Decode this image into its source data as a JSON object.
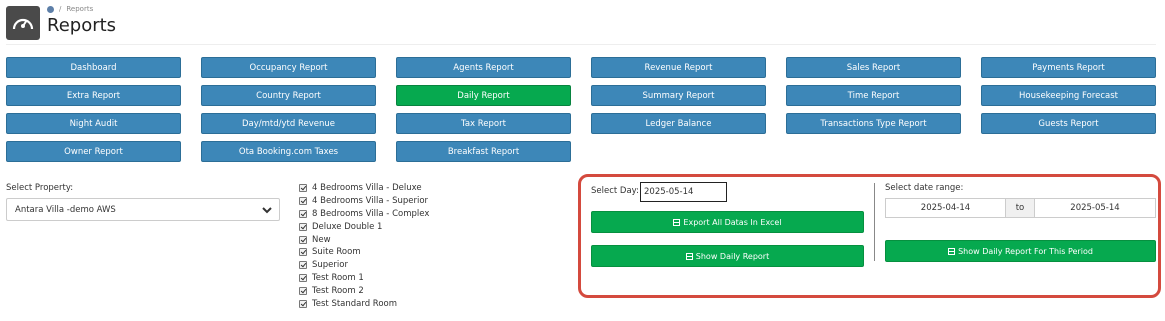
{
  "header": {
    "breadcrumb": "Reports",
    "title": "Reports"
  },
  "nav": [
    {
      "label": "Dashboard",
      "active": false
    },
    {
      "label": "Occupancy Report",
      "active": false
    },
    {
      "label": "Agents Report",
      "active": false
    },
    {
      "label": "Revenue Report",
      "active": false
    },
    {
      "label": "Sales Report",
      "active": false
    },
    {
      "label": "Payments Report",
      "active": false
    },
    {
      "label": "Extra Report",
      "active": false
    },
    {
      "label": "Country Report",
      "active": false
    },
    {
      "label": "Daily Report",
      "active": true
    },
    {
      "label": "Summary Report",
      "active": false
    },
    {
      "label": "Time Report",
      "active": false
    },
    {
      "label": "Housekeeping Forecast",
      "active": false
    },
    {
      "label": "Night Audit",
      "active": false
    },
    {
      "label": "Day/mtd/ytd Revenue",
      "active": false
    },
    {
      "label": "Tax Report",
      "active": false
    },
    {
      "label": "Ledger Balance",
      "active": false
    },
    {
      "label": "Transactions Type Report",
      "active": false
    },
    {
      "label": "Guests Report",
      "active": false
    },
    {
      "label": "Owner Report",
      "active": false
    },
    {
      "label": "Ota Booking.com Taxes",
      "active": false
    },
    {
      "label": "Breakfast Report",
      "active": false
    }
  ],
  "property": {
    "label": "Select Property:",
    "selected": "Antara Villa -demo AWS"
  },
  "rooms": [
    "4 Bedrooms Villa - Deluxe",
    "4 Bedrooms Villa - Superior",
    "8 Bedrooms Villa - Complex",
    "Deluxe Double 1",
    "New",
    "Suite Room",
    "Superior",
    "Test Room 1",
    "Test Room 2",
    "Test Standard Room"
  ],
  "daily": {
    "day_label": "Select Day:",
    "day_value": "2025-05-14",
    "export_label": "Export All Datas In Excel",
    "show_label": "Show Daily Report"
  },
  "range": {
    "label": "Select date range:",
    "from": "2025-04-14",
    "to_label": "to",
    "to": "2025-05-14",
    "button_label": "Show Daily Report For This Period"
  },
  "colors": {
    "nav_blue": "#3d87b8",
    "active_green": "#06a94f",
    "highlight_red": "#d44a3e"
  }
}
